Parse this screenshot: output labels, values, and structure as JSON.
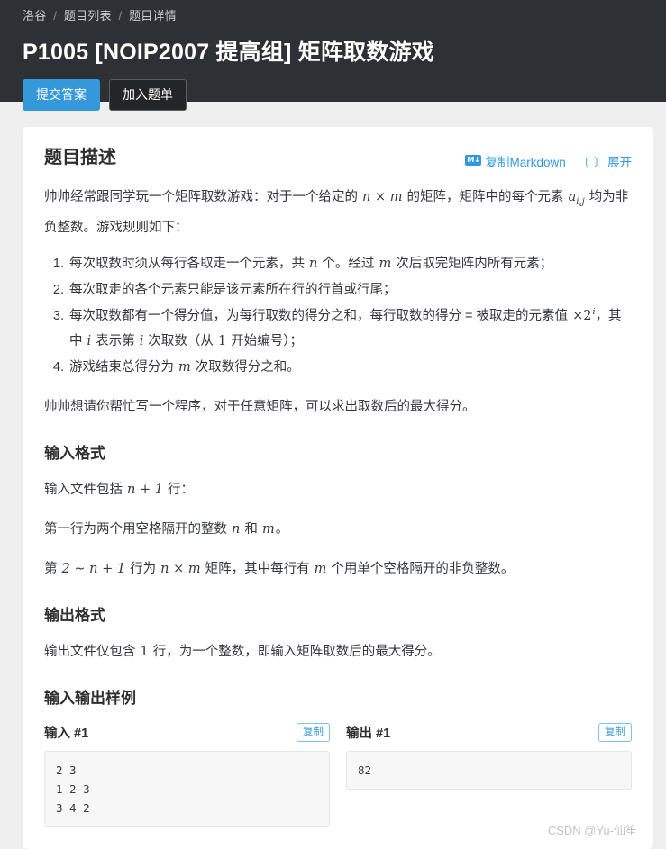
{
  "breadcrumb": {
    "items": [
      "洛谷",
      "题目列表",
      "题目详情"
    ],
    "separator": "/"
  },
  "header": {
    "title": "P1005 [NOIP2007 提高组] 矩阵取数游戏",
    "submit_label": "提交答案",
    "add_list_label": "加入题单",
    "primary_color": "#3498db",
    "background_color": "#2d3034"
  },
  "problem": {
    "description_title": "题目描述",
    "copy_markdown_label": "复制Markdown",
    "markdown_icon_text": "M↓",
    "expand_label": "展开",
    "expand_icon": "〔 〕",
    "intro_prefix": "帅帅经常跟同学玩一个矩阵取数游戏：对于一个给定的 ",
    "intro_math_1": "n × m",
    "intro_middle": " 的矩阵，矩阵中的每个元素 ",
    "intro_math_2": "a",
    "intro_math_2_sub": "i,j",
    "intro_suffix": " 均为非负整数。游戏规则如下：",
    "rules": [
      {
        "parts": [
          {
            "t": "text",
            "v": "每次取数时须从每行各取走一个元素，共 "
          },
          {
            "t": "math",
            "v": "n"
          },
          {
            "t": "text",
            "v": " 个。经过 "
          },
          {
            "t": "math",
            "v": "m"
          },
          {
            "t": "text",
            "v": " 次后取完矩阵内所有元素；"
          }
        ]
      },
      {
        "parts": [
          {
            "t": "text",
            "v": "每次取走的各个元素只能是该元素所在行的行首或行尾；"
          }
        ]
      },
      {
        "parts": [
          {
            "t": "text",
            "v": "每次取数都有一个得分值，为每行取数的得分之和，每行取数的得分 = 被取走的元素值 "
          },
          {
            "t": "math-up",
            "v": "×2"
          },
          {
            "t": "sup",
            "v": "i"
          },
          {
            "t": "text",
            "v": "，其中 "
          },
          {
            "t": "math",
            "v": "i"
          },
          {
            "t": "text",
            "v": " 表示第 "
          },
          {
            "t": "math",
            "v": "i"
          },
          {
            "t": "text",
            "v": " 次取数（从 "
          },
          {
            "t": "math-up",
            "v": "1"
          },
          {
            "t": "text",
            "v": " 开始编号）；"
          }
        ]
      },
      {
        "parts": [
          {
            "t": "text",
            "v": "游戏结束总得分为 "
          },
          {
            "t": "math",
            "v": "m"
          },
          {
            "t": "text",
            "v": " 次取数得分之和。"
          }
        ]
      }
    ],
    "closing": "帅帅想请你帮忙写一个程序，对于任意矩阵，可以求出取数后的最大得分。"
  },
  "input_format": {
    "title": "输入格式",
    "line1_prefix": "输入文件包括 ",
    "line1_math": "n + 1",
    "line1_suffix": " 行：",
    "line2_prefix": "第一行为两个用空格隔开的整数 ",
    "line2_math_1": "n",
    "line2_middle": " 和 ",
    "line2_math_2": "m",
    "line2_suffix": "。",
    "line3_prefix": "第 ",
    "line3_math_1": "2 ∼ n + 1",
    "line3_middle_1": " 行为 ",
    "line3_math_2": "n × m",
    "line3_middle_2": " 矩阵，其中每行有 ",
    "line3_math_3": "m",
    "line3_suffix": " 个用单个空格隔开的非负整数。"
  },
  "output_format": {
    "title": "输出格式",
    "line_prefix": "输出文件仅包含 ",
    "line_math": "1",
    "line_suffix": " 行，为一个整数，即输入矩阵取数后的最大得分。"
  },
  "samples": {
    "title": "输入输出样例",
    "copy_label": "复制",
    "input": {
      "label": "输入 #1",
      "content": "2 3\n1 2 3\n3 4 2"
    },
    "output": {
      "label": "输出 #1",
      "content": "82"
    }
  },
  "watermark": "CSDN @Yu-仙笙"
}
